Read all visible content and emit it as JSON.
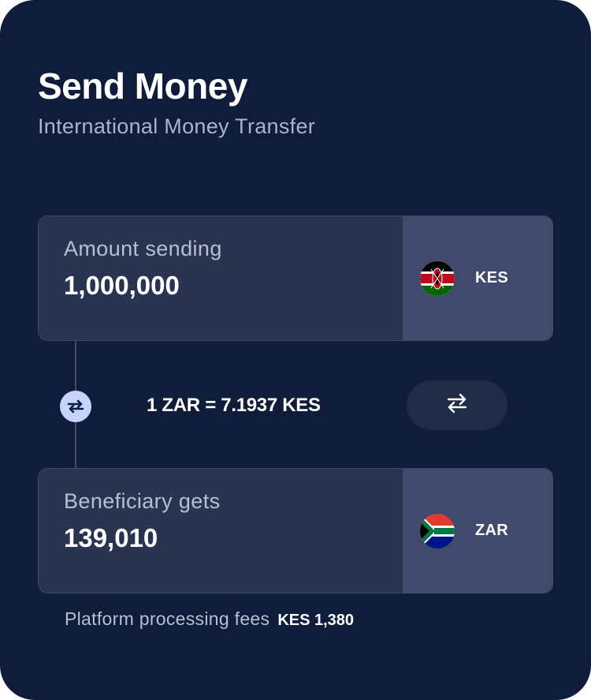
{
  "header": {
    "title": "Send Money",
    "subtitle": "International Money Transfer"
  },
  "send": {
    "label": "Amount sending",
    "amount": "1,000,000",
    "currency": "KES",
    "flag_icon": "kenya-flag-icon"
  },
  "rate": {
    "text": "1 ZAR = 7.1937 KES",
    "dot_icon": "exchange-arrows-icon"
  },
  "swap": {
    "icon": "swap-arrows-icon"
  },
  "receive": {
    "label": "Beneficiary gets",
    "amount": "139,010",
    "currency": "ZAR",
    "flag_icon": "south-africa-flag-icon"
  },
  "fees": {
    "label": "Platform processing fees",
    "value": "KES 1,380"
  },
  "colors": {
    "background": "#0f1c3a",
    "input_panel": "#283450",
    "currency_panel": "#414a6c",
    "rate_dot": "#c8d4ff",
    "swap_button": "#1f2b47"
  }
}
